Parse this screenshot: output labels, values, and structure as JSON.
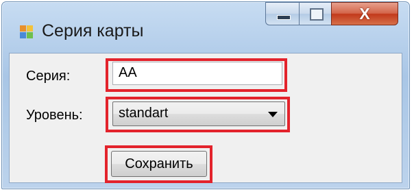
{
  "window": {
    "title": "Серия карты",
    "icon": "app-window-icon",
    "controls": {
      "minimize_icon": "minimize-icon",
      "maximize_icon": "maximize-icon",
      "close_label": "X"
    }
  },
  "form": {
    "series_label": "Серия:",
    "series_value": "AA",
    "level_label": "Уровень:",
    "level_selected": "standart",
    "save_label": "Сохранить"
  },
  "colors": {
    "highlight": "#e3232c",
    "client_bg": "#f0f0f0",
    "close_button": "#c2391b"
  }
}
